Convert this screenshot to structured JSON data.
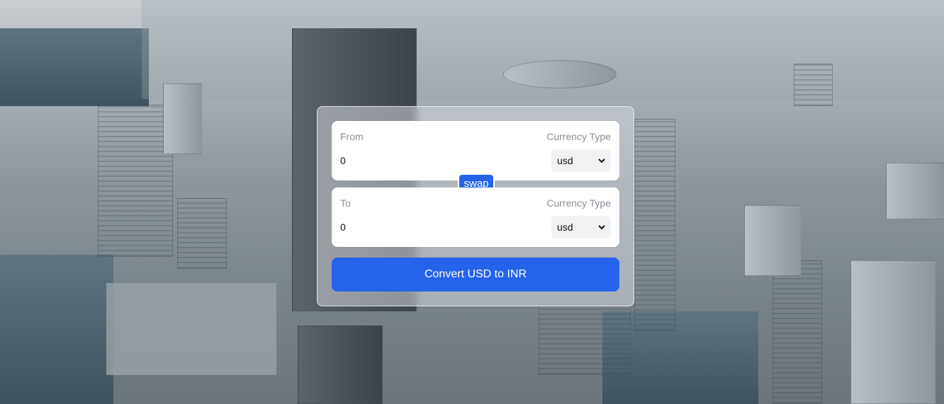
{
  "converter": {
    "from": {
      "label": "From",
      "currency_type_label": "Currency Type",
      "amount": "0",
      "currency": "usd"
    },
    "to": {
      "label": "To",
      "currency_type_label": "Currency Type",
      "amount": "0",
      "currency": "usd"
    },
    "swap_label": "swap",
    "convert_label": "Convert USD to INR"
  },
  "colors": {
    "accent": "#2563eb",
    "field_bg": "#ffffff",
    "select_bg": "#f1f2f4",
    "label_text": "#8b8f94"
  },
  "icons": {
    "select_arrow": "chevron-down-icon"
  }
}
